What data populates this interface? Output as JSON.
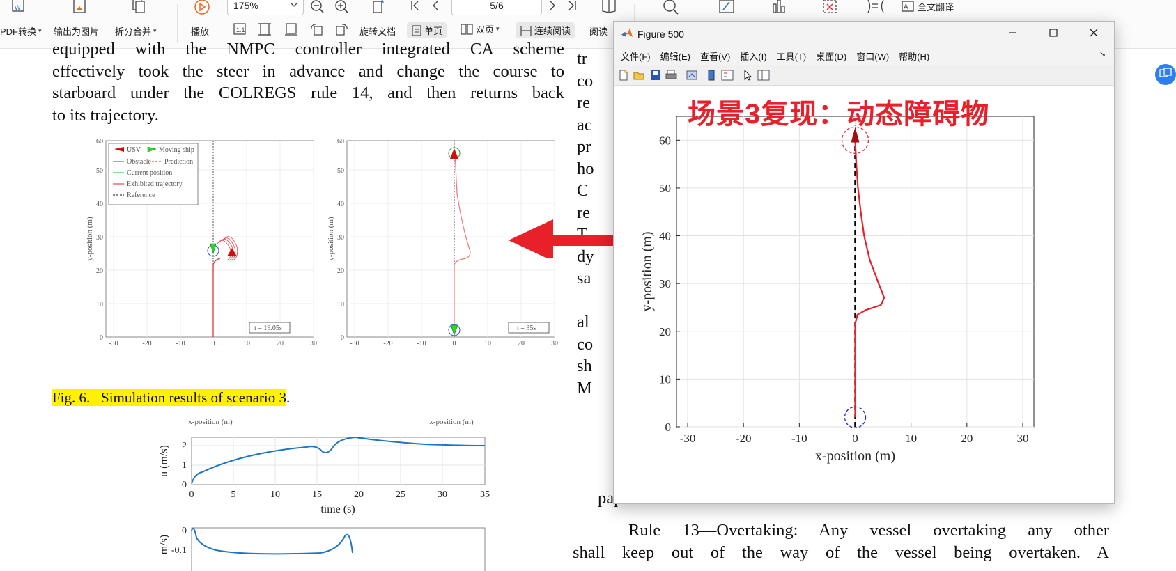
{
  "toolbar": {
    "pdf_convert": "PDF转换",
    "export_image": "输出为图片",
    "split_merge": "拆分合并",
    "play": "播放",
    "zoom": "175%",
    "page": "5/6",
    "rotate": "旋转文档",
    "single_page": "单页",
    "double_page": "双页",
    "continuous": "连续阅读",
    "read": "阅读",
    "translate_full": "全文翻译"
  },
  "document": {
    "left_para": [
      "equipped with the NMPC controller integrated CA scheme",
      "effectively took the steer in advance and change the course to",
      "starboard under the COLREGS rule 14, and then returns back",
      "to its trajectory."
    ],
    "right_col_fragments": [
      "tr",
      "co",
      "re",
      "ac",
      "pr",
      "ho",
      "C",
      "re",
      "T",
      "dy",
      "sa",
      "al",
      "co",
      "sh",
      "M",
      "paper."
    ],
    "rule13": [
      "Rule 13—Overtaking: Any vessel overtaking any other",
      "shall keep out of the way of the vessel being overtaken. A"
    ],
    "figure_caption": {
      "prefix": "Fig. 6.",
      "text": "Simulation results of scenario 3",
      "suffix": "."
    },
    "sub_plot_left": {
      "time_label": "t = 19.05s",
      "legend": [
        "USV",
        "Moving ship",
        "Obstacle",
        "Prediction",
        "Current position",
        "Exhibited trajectory",
        "Reference"
      ],
      "xlabel": "x-position (m)",
      "ylabel": "y-position (m)"
    },
    "sub_plot_right": {
      "time_label": "t = 35s",
      "xlabel": "x-position (m)",
      "ylabel": "y-position (m)"
    },
    "speed_plot": {
      "ylabel": "u (m/s)",
      "xlabel": "time (s)",
      "xticks": [
        "0",
        "5",
        "10",
        "15",
        "20",
        "25",
        "30",
        "35"
      ],
      "yticks": [
        "2",
        "1",
        "0"
      ]
    },
    "lower_plot": {
      "ylabel": "m/s)",
      "yticks": [
        "0",
        "-0.1"
      ]
    }
  },
  "figure_window": {
    "title": "Figure 500",
    "menu": [
      "文件(F)",
      "编辑(E)",
      "查看(V)",
      "插入(I)",
      "工具(T)",
      "桌面(D)",
      "窗口(W)",
      "帮助(H)"
    ],
    "scenario_title": "场景3复现：动态障碍物"
  },
  "chart_data": {
    "type": "line",
    "title": "",
    "xlabel": "x-position (m)",
    "ylabel": "y-position (m)",
    "xlim": [
      -32,
      32
    ],
    "ylim": [
      0,
      65
    ],
    "xticks": [
      -30,
      -20,
      -10,
      0,
      10,
      20,
      30
    ],
    "yticks": [
      0,
      10,
      20,
      30,
      40,
      50,
      60
    ],
    "grid": true,
    "series": [
      {
        "style": "solid-red",
        "x": [
          0,
          0,
          0.4,
          2.0,
          4.6,
          5.2,
          4.2,
          2.6,
          1.6,
          1.0,
          0.5,
          0.2,
          0
        ],
        "y": [
          2,
          21.5,
          23.5,
          24.5,
          25.5,
          27.0,
          30.0,
          35.0,
          40.0,
          45.0,
          50.0,
          55.0,
          60.0
        ]
      },
      {
        "style": "dashed-black",
        "x": [
          0,
          0
        ],
        "y": [
          0,
          63
        ]
      }
    ],
    "markers": [
      {
        "type": "usv",
        "x": 0,
        "y": 61
      },
      {
        "type": "goal-circle",
        "x": 0,
        "y": 60
      },
      {
        "type": "start-circle",
        "x": 0,
        "y": 2
      }
    ],
    "colors": {
      "trajectory": "#e8202a",
      "reference": "#000000",
      "start": "#2020e0"
    }
  }
}
